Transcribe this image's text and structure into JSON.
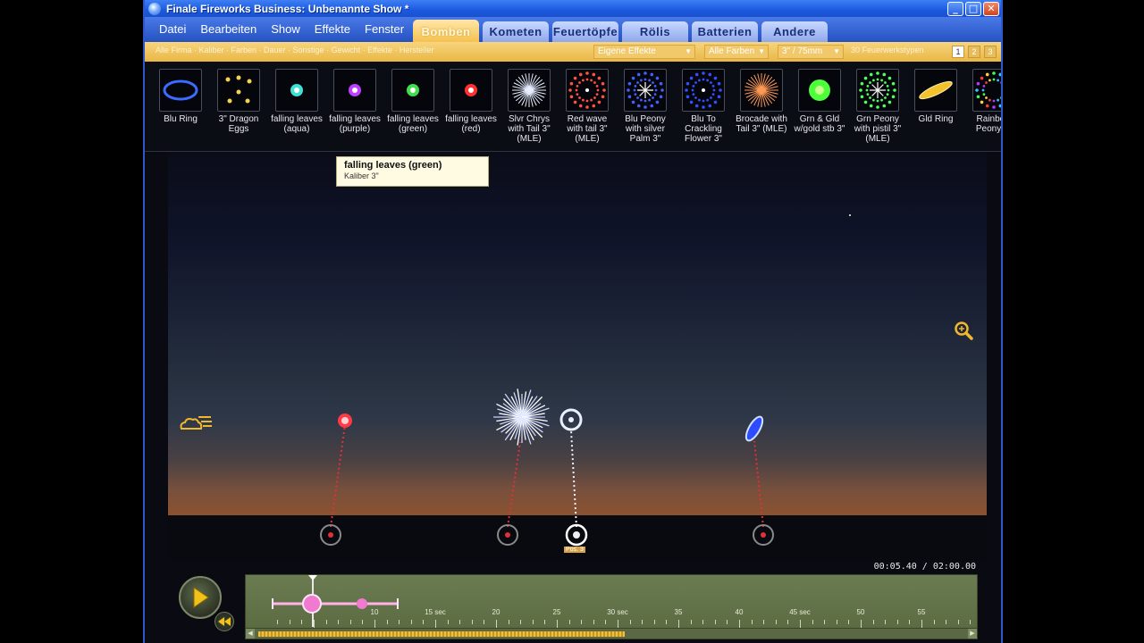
{
  "window": {
    "title": "Finale Fireworks Business: Unbenannte Show *"
  },
  "menu": [
    "Datei",
    "Bearbeiten",
    "Show",
    "Effekte",
    "Fenster"
  ],
  "category_tabs": [
    {
      "label": "Bomben",
      "active": true
    },
    {
      "label": "Kometen",
      "active": false
    },
    {
      "label": "Feuertöpfe",
      "active": false
    },
    {
      "label": "Rölis",
      "active": false
    },
    {
      "label": "Batterien",
      "active": false
    },
    {
      "label": "Andere",
      "active": false
    }
  ],
  "filters": {
    "crumbs": "Alle Firma · Kaliber · Farben · Dauer · Sonstige · Gewicht · Effekte · Hersteller",
    "effect_type": "Eigene Effekte",
    "colors": "Alle Farben",
    "caliber": "3\" / 75mm",
    "count_text": "30 Feuerwerkstypen",
    "pages": [
      "1",
      "2",
      "3"
    ],
    "active_page": "1"
  },
  "effects": [
    {
      "label": "Blu Ring",
      "color": "#3b6cff",
      "icon": "ring"
    },
    {
      "label": "3\" Dragon Eggs",
      "color": "#f6d44a",
      "icon": "dots"
    },
    {
      "label": "falling leaves (aqua)",
      "color": "#3fe0d6",
      "icon": "cluster"
    },
    {
      "label": "falling leaves (purple)",
      "color": "#c040ff",
      "icon": "cluster"
    },
    {
      "label": "falling leaves (green)",
      "color": "#3fe04a",
      "icon": "cluster"
    },
    {
      "label": "falling leaves (red)",
      "color": "#ff3030",
      "icon": "cluster"
    },
    {
      "label": "Slvr Chrys with Tail 3\" (MLE)",
      "color": "#e8eeff",
      "icon": "burst"
    },
    {
      "label": "Red wave with tail 3\" (MLE)",
      "color": "#ff5040",
      "icon": "ringdots"
    },
    {
      "label": "Blu Peony with silver Palm 3\"",
      "color": "#4060ff",
      "icon": "peony"
    },
    {
      "label": "Blu To Crackling Flower 3\"",
      "color": "#3050ff",
      "icon": "ringdots"
    },
    {
      "label": "Brocade with Tail 3\" (MLE)",
      "color": "#ff9a55",
      "icon": "burst"
    },
    {
      "label": "Grn & Gld w/gold stb 3\"",
      "color": "#4cff3a",
      "icon": "ball"
    },
    {
      "label": "Grn Peony with pistil 3\" (MLE)",
      "color": "#4cff5a",
      "icon": "peony"
    },
    {
      "label": "Gld Ring",
      "color": "#f2c22c",
      "icon": "ellipse"
    },
    {
      "label": "Rainbow Peony 3\"",
      "color": "#ff4bd0",
      "icon": "rainbow"
    }
  ],
  "tooltip": {
    "title": "falling leaves (green)",
    "subtitle": "Kaliber 3\""
  },
  "stage": {
    "icons": [
      "zoom-icon",
      "weather-icon"
    ],
    "selected_marker_label": "Pos. 3"
  },
  "timeline": {
    "readout": "00:05.40 / 02:00.00",
    "ticks": [
      {
        "label": "10",
        "sec": 10
      },
      {
        "label": "15 sec",
        "sec": 15
      },
      {
        "label": "20",
        "sec": 20
      },
      {
        "label": "25",
        "sec": 25
      },
      {
        "label": "30 sec",
        "sec": 30
      },
      {
        "label": "35",
        "sec": 35
      },
      {
        "label": "40",
        "sec": 40
      },
      {
        "label": "45 sec",
        "sec": 45
      },
      {
        "label": "50",
        "sec": 50
      },
      {
        "label": "55",
        "sec": 55
      }
    ]
  }
}
